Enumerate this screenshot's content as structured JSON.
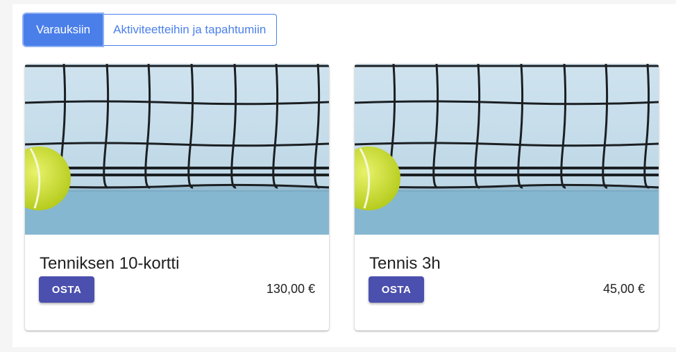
{
  "tabs": [
    {
      "label": "Varauksiin",
      "active": true
    },
    {
      "label": "Aktiviteetteihin ja tapahtumiin",
      "active": false
    }
  ],
  "products": [
    {
      "title": "Tenniksen 10-kortti",
      "button": "OSTA",
      "price": "130,00 €",
      "image": "tennis-ball-net-image"
    },
    {
      "title": "Tennis 3h",
      "button": "OSTA",
      "price": "45,00 €",
      "image": "tennis-ball-net-image"
    }
  ],
  "colors": {
    "accent": "#4a7fea",
    "button": "#4b4fae",
    "court": "#b9d4e4",
    "ball": "#d4e63a"
  }
}
